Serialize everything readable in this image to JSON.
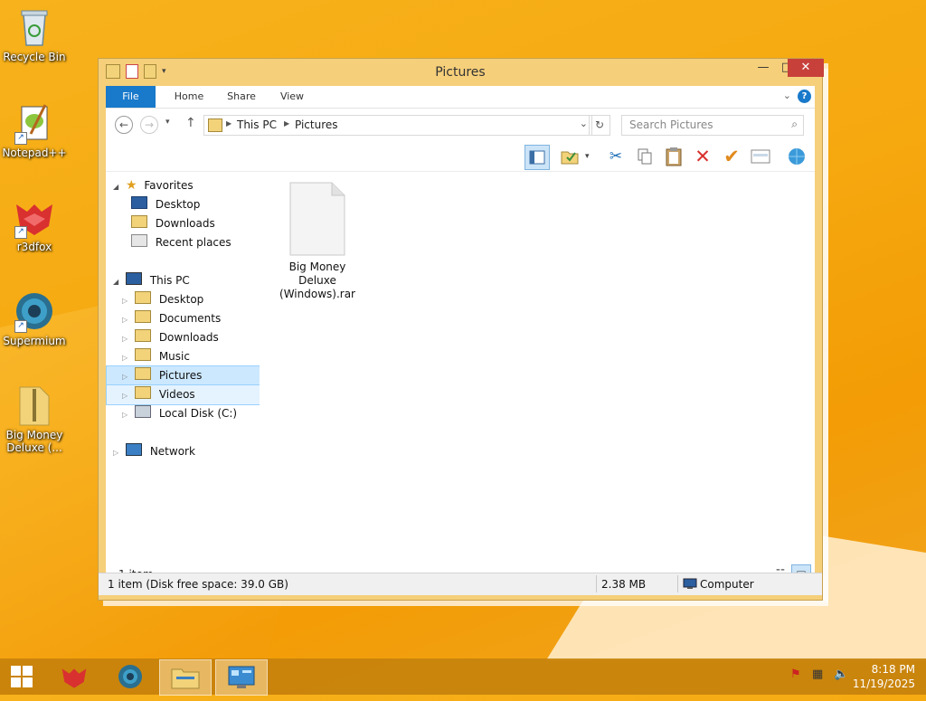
{
  "desktop": {
    "icons": [
      {
        "label": "Recycle Bin"
      },
      {
        "label": "Notepad++"
      },
      {
        "label": "r3dfox"
      },
      {
        "label": "Supermium"
      },
      {
        "label": "Big Money Deluxe (..."
      }
    ]
  },
  "window": {
    "title": "Pictures",
    "minimize": "—",
    "maximize": "□",
    "close": "✕",
    "ribbon_tabs": [
      "File",
      "Home",
      "Share",
      "View"
    ],
    "help": "?",
    "address": {
      "segments": [
        "This PC",
        "Pictures"
      ]
    },
    "search": {
      "placeholder": "Search Pictures"
    },
    "nav": {
      "favorites": {
        "label": "Favorites",
        "items": [
          "Desktop",
          "Downloads",
          "Recent places"
        ]
      },
      "this_pc": {
        "label": "This PC",
        "items": [
          "Desktop",
          "Documents",
          "Downloads",
          "Music",
          "Pictures",
          "Videos",
          "Local Disk (C:)"
        ]
      },
      "network": {
        "label": "Network"
      }
    },
    "files": [
      {
        "name": "Big Money Deluxe (Windows).rar"
      }
    ],
    "item_count": "1 item",
    "status": {
      "left": "1 item (Disk free space: 39.0 GB)",
      "size": "2.38 MB",
      "location": "Computer"
    }
  },
  "taskbar": {
    "clock_time": "8:18 PM",
    "clock_date": "11/19/2025"
  },
  "colors": {
    "accent": "#1979ca",
    "desktop": "#f6a80f",
    "close": "#c7403a"
  }
}
